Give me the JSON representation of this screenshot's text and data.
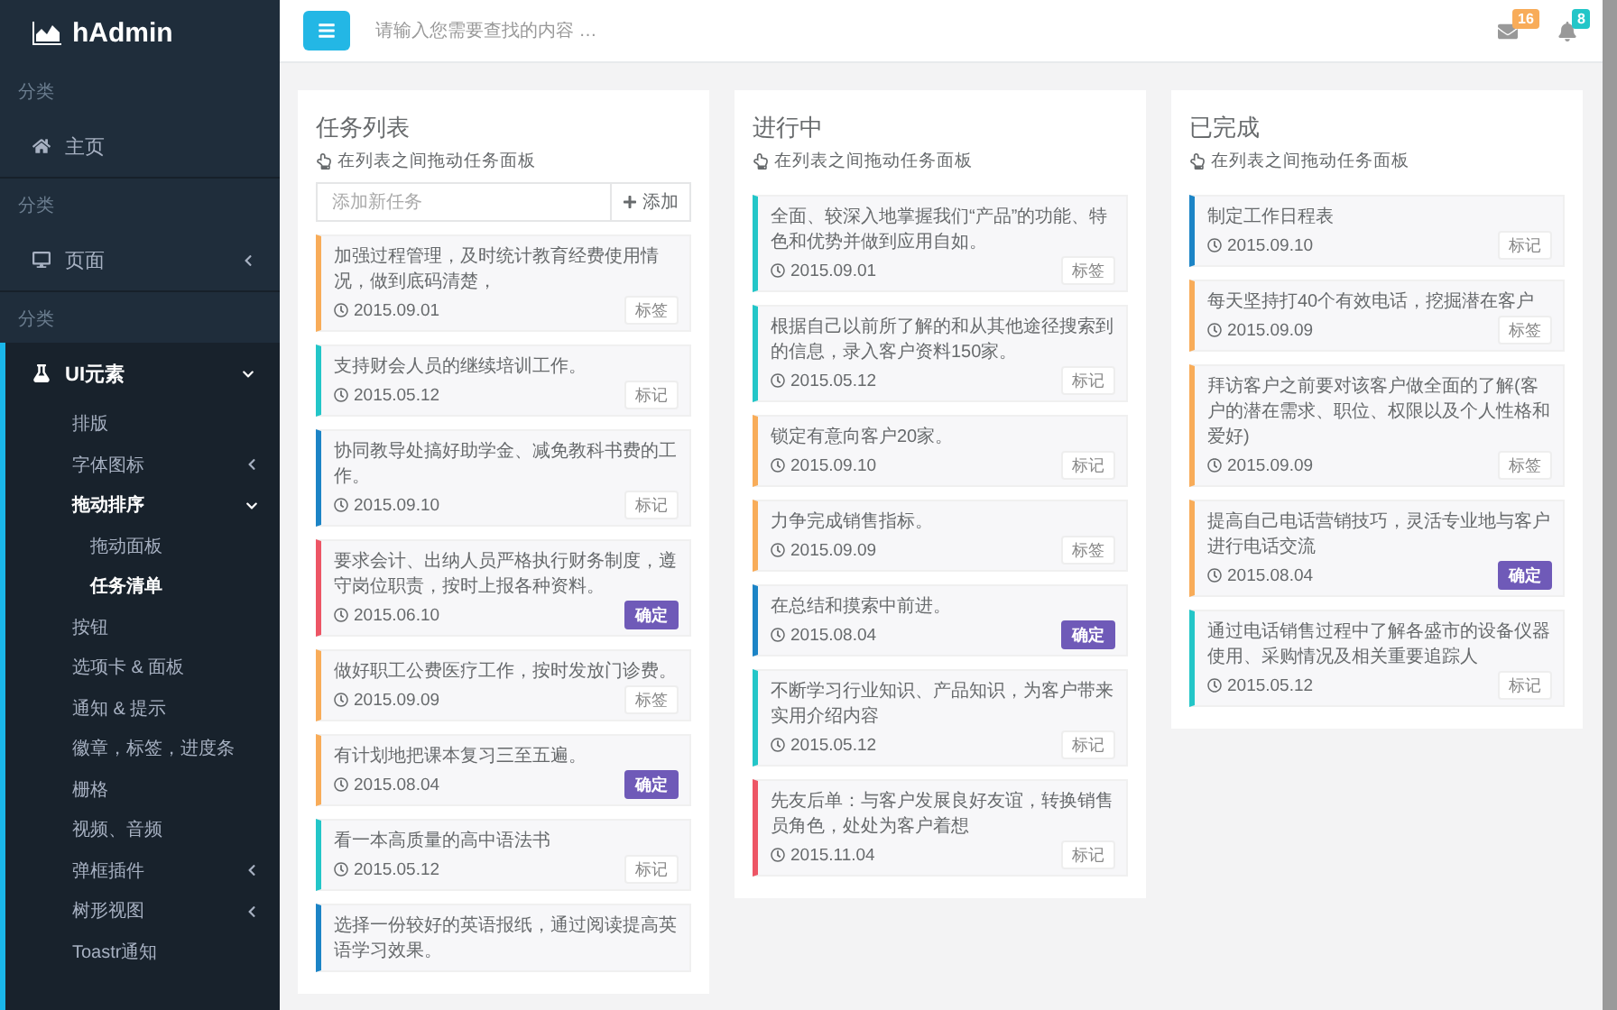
{
  "sidebar": {
    "logo": "hAdmin",
    "sections": [
      {
        "label": "分类",
        "items": [
          {
            "label": "主页"
          }
        ]
      },
      {
        "label": "分类",
        "items": [
          {
            "label": "页面",
            "expanded": false
          }
        ]
      },
      {
        "label": "分类",
        "items": [
          {
            "label": "UI元素",
            "expanded": true,
            "children": [
              {
                "label": "排版",
                "selected": false
              },
              {
                "label": "字体图标",
                "expanded": false
              },
              {
                "label": "拖动排序",
                "expanded": true,
                "children": [
                  {
                    "label": "拖动面板",
                    "selected": false
                  },
                  {
                    "label": "任务清单",
                    "selected": true
                  }
                ]
              },
              {
                "label": "按钮",
                "selected": false
              },
              {
                "label": "选项卡 & 面板",
                "selected": false
              },
              {
                "label": "通知 & 提示",
                "selected": false
              },
              {
                "label": "徽章，标签，进度条",
                "selected": false
              },
              {
                "label": "栅格",
                "selected": false
              },
              {
                "label": "视频、音频",
                "selected": false
              },
              {
                "label": "弹框插件",
                "expanded": false
              },
              {
                "label": "树形视图",
                "expanded": false
              },
              {
                "label": "Toastr通知",
                "selected": false
              }
            ]
          }
        ]
      }
    ]
  },
  "header": {
    "search": {
      "placeholder": "请输入您需要查找的内容 …"
    },
    "mail_badge": "16",
    "bell_badge": "8"
  },
  "columns": [
    {
      "title": "任务列表",
      "hint": "在列表之间拖动任务面板",
      "add": {
        "placeholder": "添加新任务",
        "button": "添加"
      },
      "tasks": [
        {
          "text": "加强过程管理，及时统计教育经费使用情况，做到底码清楚，",
          "date": "2015.09.01",
          "tag": "标签",
          "kind": "plain",
          "color": "#f8ac59"
        },
        {
          "text": "支持财会人员的继续培训工作。",
          "date": "2015.05.12",
          "tag": "标记",
          "kind": "plain",
          "color": "#23c6c8"
        },
        {
          "text": "协同教导处搞好助学金、减免教科书费的工作。",
          "date": "2015.09.10",
          "tag": "标记",
          "kind": "plain",
          "color": "#1c84c6"
        },
        {
          "text": "要求会计、出纳人员严格执行财务制度，遵守岗位职责，按时上报各种资料。",
          "date": "2015.06.10",
          "tag": "确定",
          "kind": "primary",
          "color": "#ed5565"
        },
        {
          "text": "做好职工公费医疗工作，按时发放门诊费。",
          "date": "2015.09.09",
          "tag": "标签",
          "kind": "plain",
          "color": "#f8ac59"
        },
        {
          "text": "有计划地把课本复习三至五遍。",
          "date": "2015.08.04",
          "tag": "确定",
          "kind": "primary",
          "color": "#f8ac59"
        },
        {
          "text": "看一本高质量的高中语法书",
          "date": "2015.05.12",
          "tag": "标记",
          "kind": "plain",
          "color": "#23c6c8"
        },
        {
          "text": "选择一份较好的英语报纸，通过阅读提高英语学习效果。",
          "color": "#1c84c6"
        }
      ]
    },
    {
      "title": "进行中",
      "hint": "在列表之间拖动任务面板",
      "tasks": [
        {
          "text": "全面、较深入地掌握我们“产品”的功能、特色和优势并做到应用自如。",
          "date": "2015.09.01",
          "tag": "标签",
          "kind": "plain",
          "color": "#23c6c8"
        },
        {
          "text": "根据自己以前所了解的和从其他途径搜索到的信息，录入客户资料150家。",
          "date": "2015.05.12",
          "tag": "标记",
          "kind": "plain",
          "color": "#23c6c8"
        },
        {
          "text": "锁定有意向客户20家。",
          "date": "2015.09.10",
          "tag": "标记",
          "kind": "plain",
          "color": "#f8ac59"
        },
        {
          "text": "力争完成销售指标。",
          "date": "2015.09.09",
          "tag": "标签",
          "kind": "plain",
          "color": "#f8ac59"
        },
        {
          "text": "在总结和摸索中前进。",
          "date": "2015.08.04",
          "tag": "确定",
          "kind": "primary",
          "color": "#1c84c6"
        },
        {
          "text": "不断学习行业知识、产品知识，为客户带来实用介绍内容",
          "date": "2015.05.12",
          "tag": "标记",
          "kind": "plain",
          "color": "#23c6c8"
        },
        {
          "text": "先友后单：与客户发展良好友谊，转换销售员角色，处处为客户着想",
          "date": "2015.11.04",
          "tag": "标记",
          "kind": "plain",
          "color": "#ed5565"
        }
      ]
    },
    {
      "title": "已完成",
      "hint": "在列表之间拖动任务面板",
      "tasks": [
        {
          "text": "制定工作日程表",
          "date": "2015.09.10",
          "tag": "标记",
          "kind": "plain",
          "color": "#1c84c6"
        },
        {
          "text": "每天坚持打40个有效电话，挖掘潜在客户",
          "date": "2015.09.09",
          "tag": "标签",
          "kind": "plain",
          "color": "#f8ac59"
        },
        {
          "text": "拜访客户之前要对该客户做全面的了解(客户的潜在需求、职位、权限以及个人性格和爱好)",
          "date": "2015.09.09",
          "tag": "标签",
          "kind": "plain",
          "color": "#f8ac59"
        },
        {
          "text": "提高自己电话营销技巧，灵活专业地与客户进行电话交流",
          "date": "2015.08.04",
          "tag": "确定",
          "kind": "primary",
          "color": "#f8ac59"
        },
        {
          "text": "通过电话销售过程中了解各盛市的设备仪器使用、采购情况及相关重要追踪人",
          "date": "2015.05.12",
          "tag": "标记",
          "kind": "plain",
          "color": "#23c6c8"
        }
      ]
    }
  ]
}
